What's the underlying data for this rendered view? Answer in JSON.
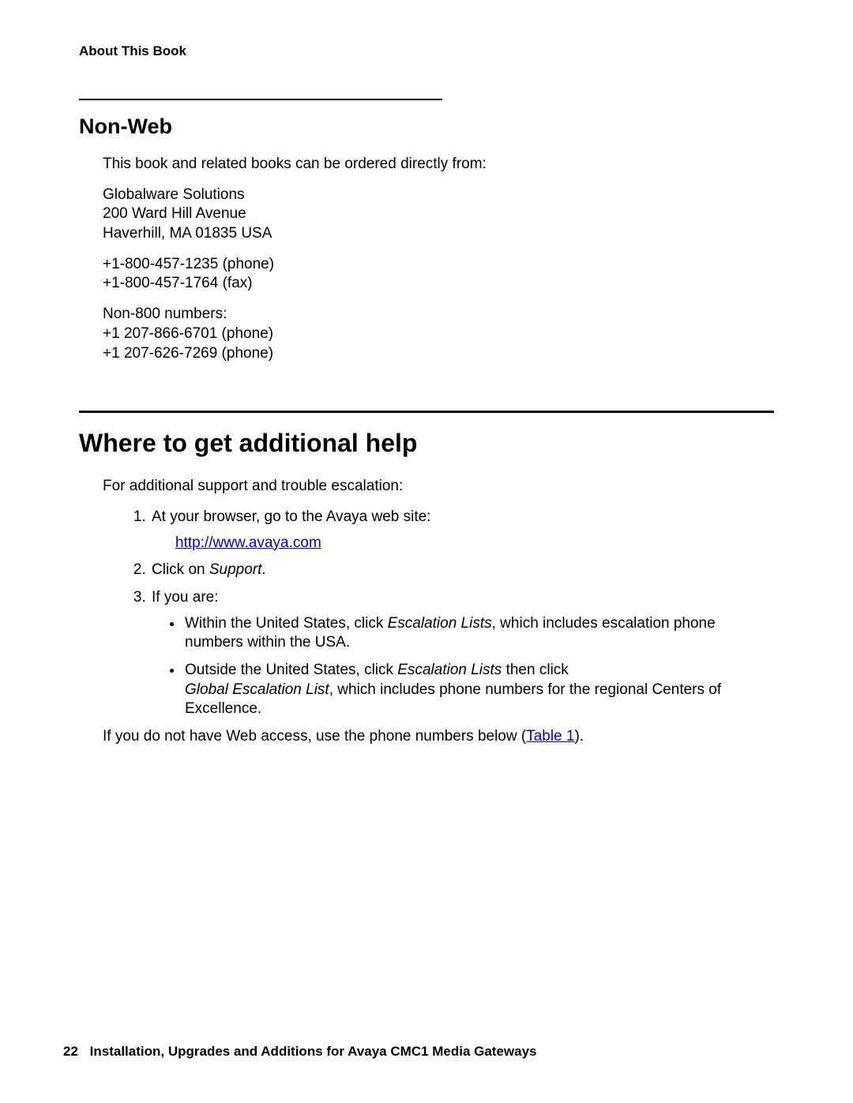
{
  "header": {
    "running": "About This Book"
  },
  "nonweb": {
    "title": "Non-Web",
    "intro": "This book and related books can be ordered directly from:",
    "addr_line1": "Globalware Solutions",
    "addr_line2": "200 Ward Hill Avenue",
    "addr_line3": "Haverhill, MA 01835 USA",
    "phone1": "+1-800-457-1235 (phone)",
    "fax": "+1-800-457-1764 (fax)",
    "non800_label": "Non-800 numbers:",
    "non800_a": "+1 207-866-6701 (phone)",
    "non800_b": "+1 207-626-7269 (phone)"
  },
  "help": {
    "title": "Where to get additional help",
    "intro": "For additional support and trouble escalation:",
    "step1": "At your browser, go to the Avaya web site:",
    "url": "http://www.avaya.com",
    "step2_prefix": "Click on ",
    "step2_italic": "Support",
    "step2_suffix": ".",
    "step3": "If you are:",
    "bullet_us_a": "Within the United States, click ",
    "escalation_lists": "Escalation Lists",
    "bullet_us_b": ", which includes escalation phone numbers within the USA.",
    "bullet_out_a": "Outside the United States, click ",
    "bullet_out_b": " then click ",
    "global_list": "Global Escalation List",
    "bullet_out_c": ", which includes phone numbers for the regional Centers of Excellence.",
    "noweb_a": "If you do not have Web access, use the phone numbers below (",
    "table_ref": "Table 1",
    "noweb_b": ")."
  },
  "footer": {
    "page": "22",
    "title": "Installation, Upgrades and Additions for Avaya CMC1 Media Gateways"
  }
}
